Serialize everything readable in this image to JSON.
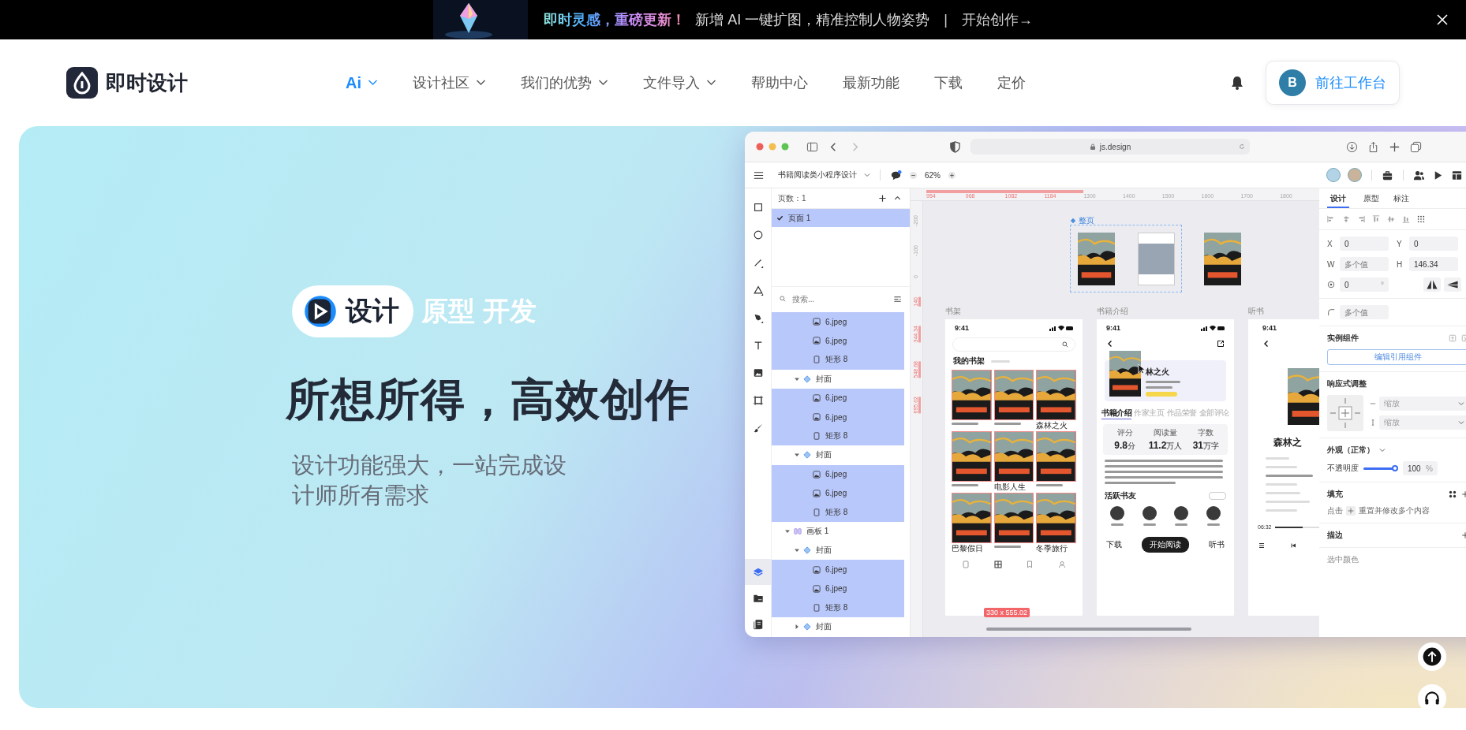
{
  "announcement": {
    "highlight": "即时灵感，重磅更新！",
    "text": "新增 AI 一键扩图，精准控制人物姿势",
    "separator": "|",
    "link": "开始创作→"
  },
  "nav": {
    "brand": "即时设计",
    "items": [
      {
        "label": "Ai",
        "selected": true,
        "has_menu": true
      },
      {
        "label": "设计社区",
        "selected": false,
        "has_menu": true
      },
      {
        "label": "我们的优势",
        "selected": false,
        "has_menu": true
      },
      {
        "label": "文件导入",
        "selected": false,
        "has_menu": true
      },
      {
        "label": "帮助中心",
        "selected": false,
        "has_menu": false
      },
      {
        "label": "最新功能",
        "selected": false,
        "has_menu": false
      },
      {
        "label": "下载",
        "selected": false,
        "has_menu": false
      },
      {
        "label": "定价",
        "selected": false,
        "has_menu": false
      }
    ],
    "avatar_initial": "B",
    "workspace_button": "前往工作台"
  },
  "hero": {
    "tags": [
      {
        "label": "设计",
        "selected": true
      },
      {
        "label": "原型",
        "selected": false
      },
      {
        "label": "开发",
        "selected": false
      }
    ],
    "title": "所想所得，高效创作",
    "subtitle": "设计功能强大，一站完成设计师所有需求"
  },
  "editor": {
    "url": "js.design",
    "file_name": "书籍阅读类小程序设计",
    "zoom": "62%",
    "tools": [
      {
        "kind": "rectangle",
        "selected": false
      },
      {
        "kind": "ellipse",
        "selected": false
      },
      {
        "kind": "line",
        "selected": false
      },
      {
        "kind": "polygon",
        "selected": false
      },
      {
        "kind": "pen",
        "selected": false
      },
      {
        "kind": "text",
        "selected": false
      },
      {
        "kind": "image",
        "selected": false
      },
      {
        "kind": "frame",
        "selected": false
      },
      {
        "kind": "brush",
        "selected": false
      }
    ],
    "panel_tabs": [
      {
        "kind": "layers",
        "selected": true
      },
      {
        "kind": "assets",
        "selected": false
      },
      {
        "kind": "library",
        "selected": false
      }
    ],
    "pages_label": "页数：1",
    "pages": [
      {
        "label": "页面 1",
        "selected": true
      }
    ],
    "search_placeholder": "搜索...",
    "layers": [
      {
        "children": [
          {
            "children": [
              {
                "kind": "image",
                "label": "6.jpeg",
                "selected": true
              },
              {
                "kind": "image",
                "label": "6.jpeg",
                "selected": true
              },
              {
                "kind": "rectangle",
                "label": "矩形 8",
                "selected": true
              }
            ]
          },
          {
            "kind": "component",
            "label": "封面",
            "selected": false,
            "expanded": true,
            "children": [
              {
                "kind": "image",
                "label": "6.jpeg",
                "selected": true
              },
              {
                "kind": "image",
                "label": "6.jpeg",
                "selected": true
              },
              {
                "kind": "rectangle",
                "label": "矩形 8",
                "selected": true
              }
            ]
          },
          {
            "kind": "component",
            "label": "封面",
            "selected": false,
            "expanded": true,
            "children": [
              {
                "kind": "image",
                "label": "6.jpeg",
                "selected": true
              },
              {
                "kind": "image",
                "label": "6.jpeg",
                "selected": true
              },
              {
                "kind": "rectangle",
                "label": "矩形 8",
                "selected": true
              }
            ]
          }
        ]
      },
      {
        "kind": "artboard",
        "label": "画板 1",
        "selected": false,
        "expanded": true,
        "children": [
          {
            "kind": "component",
            "label": "封面",
            "selected": false,
            "expanded": true,
            "children": [
              {
                "kind": "image",
                "label": "6.jpeg",
                "selected": true
              },
              {
                "kind": "image",
                "label": "6.jpeg",
                "selected": true
              },
              {
                "kind": "rectangle",
                "label": "矩形 8",
                "selected": true
              }
            ]
          },
          {
            "kind": "component",
            "label": "封面",
            "selected": false,
            "expanded": false
          }
        ]
      }
    ],
    "ruler_x": [
      {
        "label": "954",
        "marked": true
      },
      {
        "label": "968",
        "marked": true
      },
      {
        "label": "1082",
        "marked": true
      },
      {
        "label": "1184",
        "marked": true
      },
      {
        "label": "1300",
        "marked": false
      },
      {
        "label": "1400",
        "marked": false
      },
      {
        "label": "1500",
        "marked": false
      },
      {
        "label": "1600",
        "marked": false
      },
      {
        "label": "1700",
        "marked": false
      },
      {
        "label": "1800",
        "marked": false
      }
    ],
    "ruler_y": [
      {
        "label": "-200",
        "marked": false
      },
      {
        "label": "-100",
        "marked": false
      },
      {
        "label": "0",
        "marked": false
      },
      {
        "label": "140",
        "marked": true
      },
      {
        "label": "344.34",
        "marked": true
      },
      {
        "label": "548.68",
        "marked": true
      },
      {
        "label": "695.02",
        "marked": true
      }
    ],
    "group_label": "整页",
    "frames": [
      {
        "kind": "shelf",
        "label": "书架",
        "time": "9:41",
        "section": "我的书架",
        "books": [
          {
            "selected": true
          },
          {
            "selected": true
          },
          {
            "title": "森林之火",
            "selected": true
          },
          {
            "selected": true
          },
          {
            "title": "电影人生",
            "selected": true
          },
          {
            "selected": true
          },
          {
            "title": "巴黎假日",
            "selected": true
          },
          {
            "selected": true
          },
          {
            "title": "冬季旅行",
            "selected": true
          }
        ]
      },
      {
        "kind": "detail",
        "label": "书籍介绍",
        "time": "9:41",
        "title": "林之火",
        "tabs": [
          {
            "label": "书籍介绍",
            "selected": true
          },
          {
            "label": "作家主页",
            "selected": false
          },
          {
            "label": "作品荣誉",
            "selected": false
          },
          {
            "label": "全部评论",
            "selected": false
          }
        ],
        "stats": [
          {
            "label": "评分",
            "value": "9.8",
            "unit": "分"
          },
          {
            "label": "阅读量",
            "value": "11.2",
            "unit": "万人"
          },
          {
            "label": "字数",
            "value": "31",
            "unit": "万字"
          }
        ],
        "readers_title": "活跃书友",
        "actions": [
          "下载",
          "开始阅读",
          "听书"
        ]
      },
      {
        "kind": "player",
        "label": "听书",
        "time": "9:41",
        "title": "森林之",
        "elapsed": "06:32",
        "level": 0.35
      }
    ],
    "dimension_badge": "330 x 555.02",
    "inspector": {
      "tabs": [
        {
          "label": "设计",
          "selected": true
        },
        {
          "label": "原型",
          "selected": false
        },
        {
          "label": "标注",
          "selected": false
        }
      ],
      "fields": [
        {
          "label": "X",
          "value": "0"
        },
        {
          "label": "Y",
          "value": "0"
        },
        {
          "label": "W",
          "placeholder": "多个值"
        },
        {
          "label": "H",
          "value": "146.34"
        }
      ],
      "rotation": {
        "value": "0",
        "unit": "°"
      },
      "radius_placeholder": "多个值",
      "instance_title": "实例组件",
      "instance_button": "编辑引用组件",
      "responsive_title": "响应式调整",
      "horizontal": "缩放",
      "vertical": "缩放",
      "appearance_title": "外观（正常）",
      "opacity_label": "不透明度",
      "opacity": {
        "level": 1,
        "value": "100",
        "unit": "%"
      },
      "fill_title": "填充",
      "fill_hint_prefix": "点击",
      "fill_hint": "重置并修改多个内容",
      "stroke_title": "描边",
      "selection_colors_title": "选中颜色"
    }
  }
}
